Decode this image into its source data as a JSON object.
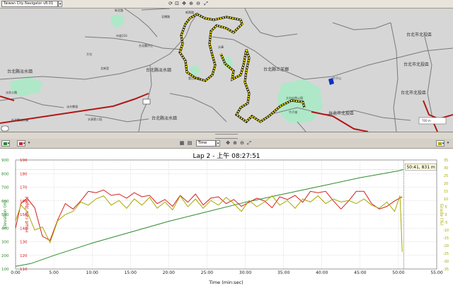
{
  "app": {
    "title": "Taiwan City Navigator v8.01"
  },
  "toolbar_top": {
    "icons": [
      "refresh-icon",
      "zoom-area-icon",
      "zoom-in-icon",
      "zoom-out-icon",
      "pan-icon",
      "fit-icon"
    ]
  },
  "map": {
    "labels": {
      "newbei_rd": "新興路",
      "road_n1": "北橋路",
      "xinbei_rd2": "新北路",
      "road_116": "市道116",
      "road_w": "台北縣汐止",
      "water_nw": "台北縣淡水鎮",
      "beixin": "北新里",
      "water_c": "台北縣淡水鎮",
      "sanzhi": "台北縣三芝鄉",
      "shuixiang": "淡水鄉道",
      "ridgeline": "登山步道",
      "reservoir": "水庫",
      "park": "大屯自然公園",
      "nanbei": "台北市北投區",
      "nanbei2": "台北市北投區",
      "beitou3": "台北市北投區",
      "northwest_rd": "淡金公路",
      "bottom_left": "台北縣淡水鎮",
      "bottom_road": "水源第二段",
      "bottom_mid": "台北縣淡水鎮",
      "hill": "竹子山",
      "scale": "700 m",
      "qiaotou": "大屯",
      "bottom_right_road": "台北市北投區",
      "zhuzi": "竹子湖"
    }
  },
  "toolbar2": {
    "left_selectors": [
      "color-green",
      "color-red"
    ],
    "axis_mode": "Time",
    "right_selector": "color-olive"
  },
  "chart_data": {
    "type": "line",
    "title": "Lap 2 - 上午 08:27:51",
    "xlabel": "Time (min:sec)",
    "x_ticks": [
      "0:00",
      "5:00",
      "10:00",
      "15:00",
      "20:00",
      "25:00",
      "30:00",
      "35:00",
      "40:00",
      "45:00",
      "50:00",
      "55:00"
    ],
    "xlim": [
      0,
      55
    ],
    "axes": {
      "elevation": {
        "label": "Elevation (m)",
        "color": "#2e8b2e",
        "ylim": [
          100,
          900
        ],
        "ticks": [
          "100",
          "200",
          "300",
          "400",
          "500",
          "600",
          "700",
          "800",
          "900"
        ]
      },
      "heart_rate": {
        "label": "Heart rate (bpm)",
        "color": "#d42020",
        "ylim": [
          110,
          190
        ],
        "ticks": [
          "110",
          "120",
          "130",
          "140",
          "150",
          "160",
          "170",
          "180",
          "190"
        ]
      },
      "grade": {
        "label": "Grade (%)",
        "color": "#a8a800",
        "ylim": [
          -35,
          35
        ],
        "ticks": [
          "-35",
          "-30",
          "-25",
          "-20",
          "-15",
          "-10",
          "-5",
          "0",
          "5",
          "10",
          "15",
          "20",
          "25",
          "30",
          "35"
        ]
      }
    },
    "series": [
      {
        "name": "Elevation (m)",
        "axis": "elevation",
        "x": [
          0,
          2,
          5,
          10,
          15,
          20,
          25,
          30,
          35,
          40,
          45,
          50,
          50.7
        ],
        "y": [
          120,
          140,
          200,
          290,
          370,
          450,
          520,
          590,
          650,
          710,
          770,
          820,
          831
        ]
      },
      {
        "name": "Heart rate (bpm)",
        "axis": "heart_rate",
        "x": [
          0,
          0.7,
          1.5,
          2.5,
          3.5,
          4.5,
          5.5,
          6.5,
          7.5,
          8.5,
          9.5,
          10.5,
          11.5,
          12.5,
          13.5,
          14.5,
          15.5,
          16.5,
          17.5,
          18.5,
          19.5,
          20.5,
          21.5,
          22.5,
          23.5,
          24.5,
          25.5,
          26.5,
          27.5,
          28.5,
          29.5,
          30.5,
          31.5,
          32.5,
          33.5,
          34.5,
          35.5,
          36.5,
          37.5,
          38.5,
          39.5,
          40.5,
          41.5,
          42.5,
          43.5,
          44.5,
          45.5,
          46.5,
          47.5,
          48.5,
          49.5,
          50.5
        ],
        "y": [
          140,
          158,
          162,
          155,
          134,
          131,
          146,
          158,
          154,
          160,
          167,
          166,
          168,
          164,
          165,
          162,
          166,
          163,
          164,
          158,
          161,
          156,
          164,
          159,
          165,
          157,
          162,
          163,
          158,
          161,
          156,
          159,
          162,
          160,
          155,
          163,
          161,
          164,
          159,
          167,
          166,
          167,
          160,
          154,
          160,
          167,
          167,
          158,
          154,
          156,
          160,
          163
        ]
      },
      {
        "name": "Grade (%)",
        "axis": "grade",
        "x": [
          0,
          0.7,
          1.5,
          2.5,
          3.5,
          4.5,
          5.5,
          6.5,
          7.5,
          8.5,
          9.5,
          10.5,
          11.5,
          12.5,
          13.5,
          14.5,
          15.5,
          16.5,
          17.5,
          18.5,
          19.5,
          20.5,
          21.5,
          22.5,
          23.5,
          24.5,
          25.5,
          26.5,
          27.5,
          28.5,
          29.5,
          30.5,
          31.5,
          32.5,
          33.5,
          34.5,
          35.5,
          36.5,
          37.5,
          38.5,
          39.5,
          40.5,
          41.5,
          42.5,
          43.5,
          44.5,
          45.5,
          46.5,
          47.5,
          48.5,
          49.5,
          50.2,
          50.5
        ],
        "y": [
          -4,
          6,
          2,
          -10,
          -8,
          -18,
          -4,
          0,
          2,
          8,
          6,
          10,
          12,
          6,
          9,
          4,
          10,
          6,
          11,
          4,
          8,
          3,
          12,
          5,
          10,
          4,
          9,
          6,
          11,
          7,
          2,
          9,
          5,
          8,
          12,
          6,
          9,
          4,
          10,
          8,
          12,
          7,
          10,
          8,
          9,
          7,
          10,
          6,
          4,
          8,
          2,
          12,
          -24
        ]
      }
    ],
    "cursor": {
      "x": 50.7,
      "readout": "50:41, 831 m"
    },
    "grid": true,
    "legend": "none"
  }
}
